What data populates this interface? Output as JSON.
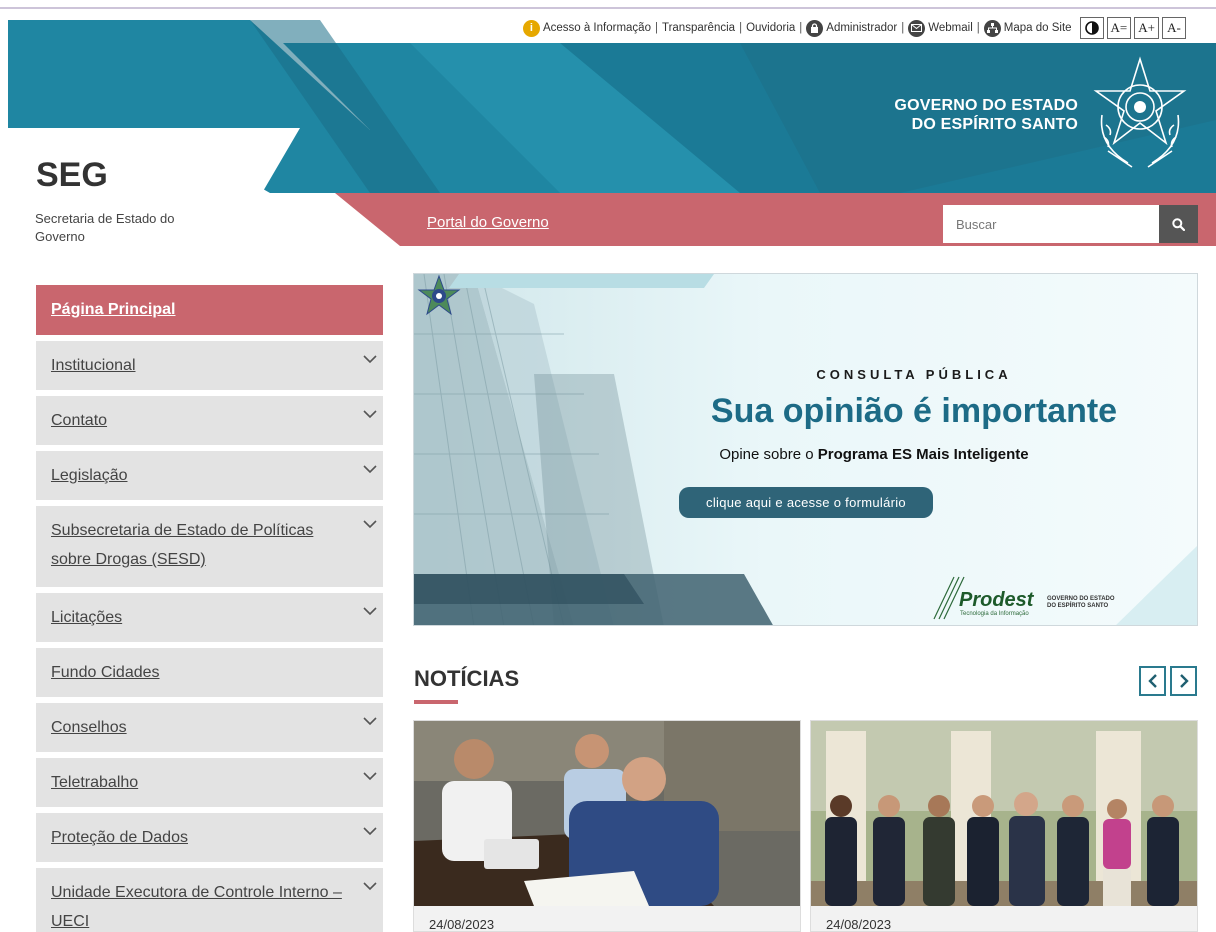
{
  "utility": {
    "acesso": "Acesso à Informação",
    "transparencia": "Transparência",
    "ouvidoria": "Ouvidoria",
    "administrador": "Administrador",
    "webmail": "Webmail",
    "mapa": "Mapa do Site",
    "sep": "|",
    "contrast_icon": "contrast-icon",
    "font_reset": "A=",
    "font_increase": "A+",
    "font_decrease": "A-"
  },
  "header": {
    "gov_line1": "GOVERNO DO ESTADO",
    "gov_line2": "DO ESPÍRITO SANTO",
    "site_title": "SEG",
    "site_subtitle": "Secretaria de Estado do Governo",
    "portal_link": "Portal do Governo",
    "search_placeholder": "Buscar",
    "colors": {
      "teal": "#1f7d97",
      "rose": "#c9666e"
    }
  },
  "sidebar": {
    "items": [
      {
        "label": "Página Principal",
        "active": true,
        "submenu": false
      },
      {
        "label": "Institucional",
        "submenu": true
      },
      {
        "label": "Contato",
        "submenu": true
      },
      {
        "label": "Legislação",
        "submenu": true
      },
      {
        "label": "Subsecretaria de Estado de Políticas sobre Drogas (SESD)",
        "submenu": true
      },
      {
        "label": "Licitações",
        "submenu": true
      },
      {
        "label": "Fundo Cidades",
        "submenu": false
      },
      {
        "label": "Conselhos",
        "submenu": true
      },
      {
        "label": "Teletrabalho",
        "submenu": true
      },
      {
        "label": "Proteção de Dados",
        "submenu": true
      },
      {
        "label": "Unidade Executora de Controle Interno – UECI",
        "submenu": true
      }
    ]
  },
  "banner": {
    "kicker": "CONSULTA PÚBLICA",
    "title": "Sua opinião é importante",
    "subtitle_prefix": "Opine sobre o ",
    "subtitle_bold": "Programa ES Mais Inteligente",
    "button": "clique aqui e acesse o formulário",
    "prodest": "Prodest",
    "prodest_sub": "Tecnologia da Informação",
    "gov_line1": "GOVERNO DO ESTADO",
    "gov_line2": "DO ESPÍRITO SANTO"
  },
  "news": {
    "heading": "NOTÍCIAS",
    "cards": [
      {
        "date": "24/08/2023"
      },
      {
        "date": "24/08/2023"
      }
    ]
  }
}
